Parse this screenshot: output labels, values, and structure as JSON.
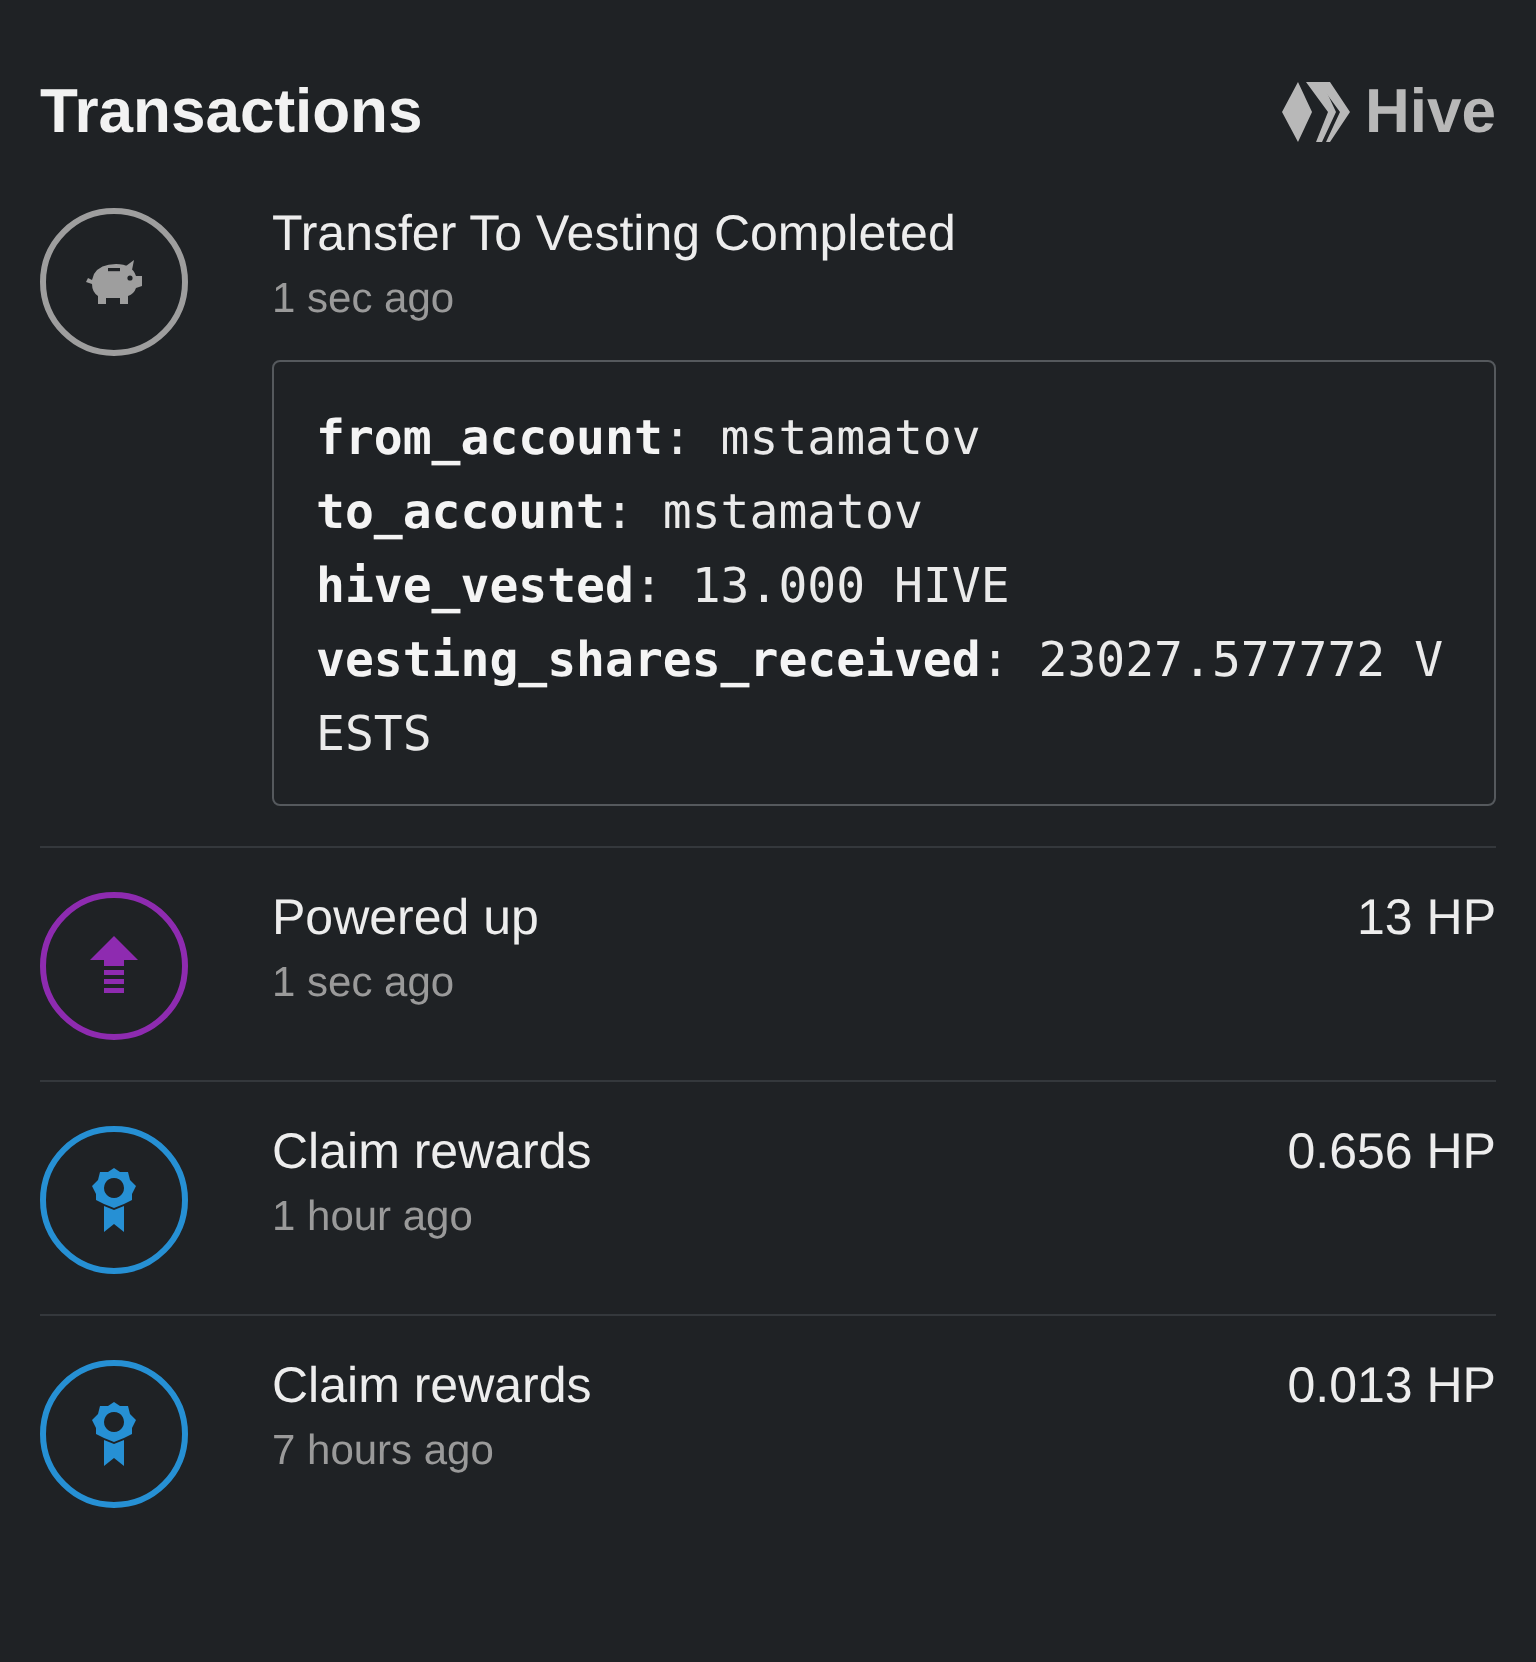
{
  "header": {
    "title": "Transactions",
    "brand": "Hive"
  },
  "transactions": [
    {
      "kind": "piggy",
      "color": "#9e9e9e",
      "title": "Transfer To Vesting Completed",
      "time": "1 sec ago",
      "details": [
        "**from_account**: mstamatov",
        "**to_account**: mstamatov",
        "**hive_vested**: 13.000 HIVE",
        "**vesting_shares_received**: 23027.577772 VESTS"
      ]
    },
    {
      "kind": "power-up",
      "color": "#8e2bb0",
      "title": "Powered up",
      "time": "1 sec ago",
      "amount": "13 HP"
    },
    {
      "kind": "reward",
      "color": "#2690d4",
      "title": "Claim rewards",
      "time": "1 hour ago",
      "amount": "0.656 HP"
    },
    {
      "kind": "reward",
      "color": "#2690d4",
      "title": "Claim rewards",
      "time": "7 hours ago",
      "amount": "0.013 HP"
    }
  ]
}
